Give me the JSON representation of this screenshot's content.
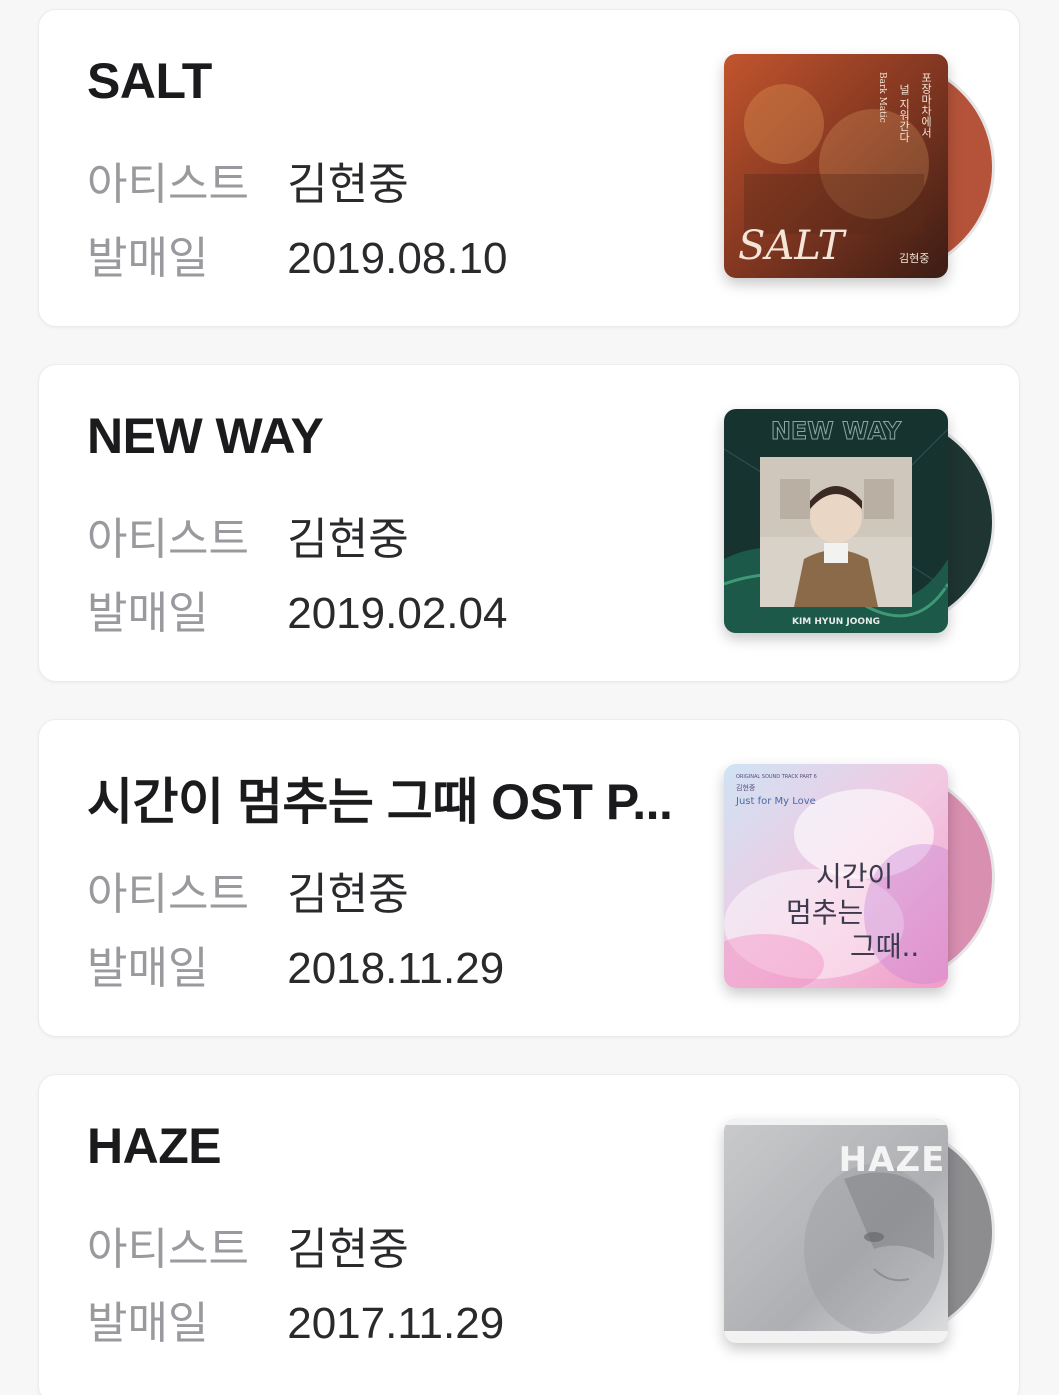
{
  "labels": {
    "artist": "아티스트",
    "release": "발매일"
  },
  "albums": [
    {
      "title": "SALT",
      "artist": "김현중",
      "release_date": "2019.08.10",
      "cover": {
        "script_text": "SALT",
        "vertical_1": "포장마차에서",
        "vertical_2": "널 지워간다",
        "vertical_3": "Bark Matic",
        "name": "김현중"
      },
      "disc_color": "#b5533a"
    },
    {
      "title": "NEW WAY",
      "artist": "김현중",
      "release_date": "2019.02.04",
      "cover": {
        "top_text": "NEW WAY",
        "bottom_text": "KIM HYUN JOONG"
      },
      "disc_color": "#1f3531"
    },
    {
      "title": "시간이 멈추는 그때 OST P...",
      "artist": "김현중",
      "release_date": "2018.11.29",
      "cover": {
        "small_text": "ORIGINAL SOUND TRACK PART 6",
        "name": "김현중",
        "song": "Just for My Love",
        "line1": "시간이",
        "line2": "멈추는",
        "line3": "그때.."
      },
      "disc_color": "#d98fb0"
    },
    {
      "title": "HAZE",
      "artist": "김현중",
      "release_date": "2017.11.29",
      "cover": {
        "top_text": "HAZE"
      },
      "disc_color": "#8d8d90"
    }
  ]
}
